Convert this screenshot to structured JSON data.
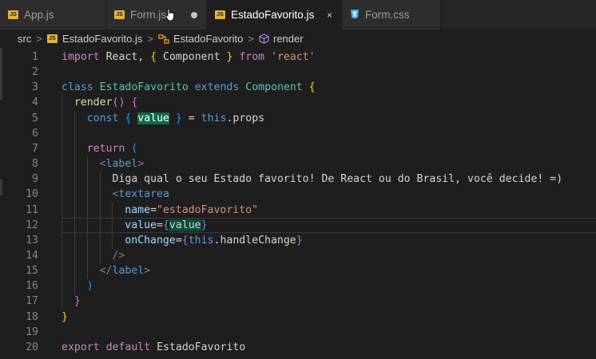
{
  "tabs": [
    {
      "label": "App.js",
      "icon": "js-icon",
      "state": "inactive"
    },
    {
      "label": "Form.js",
      "icon": "js-icon",
      "state": "modified"
    },
    {
      "label": "EstadoFavorito.js",
      "icon": "js-icon",
      "state": "active"
    },
    {
      "label": "Form.css",
      "icon": "css-icon",
      "state": "inactive"
    }
  ],
  "breadcrumb": {
    "folder": "src",
    "file": "EstadoFavorito.js",
    "component": "EstadoFavorito",
    "method": "render"
  },
  "lines": [
    {
      "n": "1",
      "indent": 0,
      "tokens": [
        [
          "import ",
          "kw"
        ],
        [
          "React, ",
          "plain"
        ],
        [
          "{ ",
          "b1"
        ],
        [
          "Component ",
          "plain"
        ],
        [
          "} ",
          "b1"
        ],
        [
          "from ",
          "kw"
        ],
        [
          "'react'",
          "str"
        ]
      ]
    },
    {
      "n": "2",
      "indent": 0,
      "tokens": []
    },
    {
      "n": "3",
      "indent": 0,
      "tokens": [
        [
          "class ",
          "kw2"
        ],
        [
          "EstadoFavorito ",
          "cls"
        ],
        [
          "extends ",
          "kw2"
        ],
        [
          "Component ",
          "cls"
        ],
        [
          "{",
          "b1"
        ]
      ]
    },
    {
      "n": "4",
      "indent": 1,
      "tokens": [
        [
          "render",
          "fn"
        ],
        [
          "()",
          "b2"
        ],
        [
          " ",
          "plain"
        ],
        [
          "{",
          "b2"
        ]
      ]
    },
    {
      "n": "5",
      "indent": 2,
      "tokens": [
        [
          "const ",
          "kw2"
        ],
        [
          "{ ",
          "b3"
        ],
        [
          "value",
          "hl"
        ],
        [
          " } ",
          "b3"
        ],
        [
          "= ",
          "plain"
        ],
        [
          "this",
          "kw2"
        ],
        [
          ".props",
          "plain"
        ]
      ]
    },
    {
      "n": "6",
      "indent": 2,
      "tokens": []
    },
    {
      "n": "7",
      "indent": 2,
      "tokens": [
        [
          "return ",
          "kw"
        ],
        [
          "(",
          "b3"
        ]
      ]
    },
    {
      "n": "8",
      "indent": 3,
      "tokens": [
        [
          "<",
          "tagc"
        ],
        [
          "label",
          "kw2"
        ],
        [
          ">",
          "tagc"
        ]
      ]
    },
    {
      "n": "9",
      "indent": 4,
      "tokens": [
        [
          "Diga qual o seu Estado favorito! De React ou do Brasil, você decide! =)",
          "plain"
        ]
      ]
    },
    {
      "n": "10",
      "indent": 4,
      "tokens": [
        [
          "<",
          "tagc"
        ],
        [
          "textarea",
          "kw2"
        ]
      ]
    },
    {
      "n": "11",
      "indent": 5,
      "tokens": [
        [
          "name",
          "var"
        ],
        [
          "=",
          "plain"
        ],
        [
          "\"estadoFavorito\"",
          "str"
        ]
      ]
    },
    {
      "n": "12",
      "indent": 5,
      "tokens": [
        [
          "value",
          "var"
        ],
        [
          "=",
          "plain"
        ],
        [
          "{",
          "kw2"
        ],
        [
          "value",
          "hl2"
        ],
        [
          "}",
          "kw2"
        ]
      ]
    },
    {
      "n": "13",
      "indent": 5,
      "tokens": [
        [
          "onChange",
          "var"
        ],
        [
          "=",
          "plain"
        ],
        [
          "{",
          "kw2"
        ],
        [
          "this",
          "kw2"
        ],
        [
          ".handleChange",
          "plain"
        ],
        [
          "}",
          "kw2"
        ]
      ]
    },
    {
      "n": "14",
      "indent": 4,
      "tokens": [
        [
          "/>",
          "tagc"
        ]
      ]
    },
    {
      "n": "15",
      "indent": 3,
      "tokens": [
        [
          "</",
          "tagc"
        ],
        [
          "label",
          "kw2"
        ],
        [
          ">",
          "tagc"
        ]
      ]
    },
    {
      "n": "16",
      "indent": 2,
      "tokens": [
        [
          ")",
          "b3"
        ]
      ]
    },
    {
      "n": "17",
      "indent": 1,
      "tokens": [
        [
          "}",
          "b2"
        ]
      ]
    },
    {
      "n": "18",
      "indent": 0,
      "tokens": [
        [
          "}",
          "b1"
        ]
      ]
    },
    {
      "n": "19",
      "indent": 0,
      "tokens": []
    },
    {
      "n": "20",
      "indent": 0,
      "tokens": [
        [
          "export ",
          "kw"
        ],
        [
          "default ",
          "kw"
        ],
        [
          "EstadoFavorito",
          "plain"
        ]
      ]
    }
  ],
  "current_line": "12",
  "colors": {
    "tab_active": "#1e1e1e",
    "tab_inactive": "#2d2d2d",
    "js_icon": "#e0b33b",
    "css_icon": "#42a5f5",
    "highlight": "#0e6a4a"
  }
}
